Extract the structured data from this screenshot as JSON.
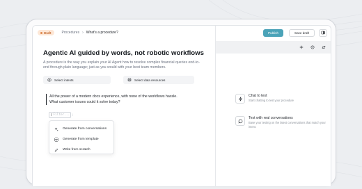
{
  "breadcrumb": {
    "draft_label": "Draft",
    "parent": "Procedures",
    "separator": "›",
    "current": "What's a procedure?"
  },
  "header": {
    "publish_label": "Publish",
    "save_label": "Save draft"
  },
  "editor": {
    "title": "Agentic AI guided by words, not robotic workflows",
    "description": "A procedure is the way you explain your AI Agent how to resolve complex financial queries end-to-end through plain language; just as you would with your best team members.",
    "select_intents_label": "Select intents",
    "select_data_label": "Select data resources",
    "quote_line_1": "All the power of a modern docs experience, with none of the workflows hassle.",
    "quote_line_2": "What customer issues could it solve today?",
    "chip_slash": "/",
    "chip_placeholder": "Filter...",
    "chip_handle": "⁝"
  },
  "insert_menu": {
    "items": [
      {
        "label": "Generate from conversations",
        "icon": "sparkle-icon"
      },
      {
        "label": "Generate from template",
        "icon": "template-icon"
      },
      {
        "label": "Write from scratch",
        "icon": "pencil-icon"
      }
    ]
  },
  "test_panel": {
    "toolbar_icons": [
      "plus-icon",
      "history-icon",
      "refresh-icon"
    ],
    "chat": {
      "title": "Chat to test",
      "subtitle": "Start chatting to test your procedure"
    },
    "real": {
      "title": "Test with real conversations",
      "subtitle": "Base your testing on the latest conversations that match your intent."
    }
  },
  "colors": {
    "accent": "#4ba3b8",
    "draft_bg": "#fde7d6",
    "draft_text": "#c2662b"
  }
}
